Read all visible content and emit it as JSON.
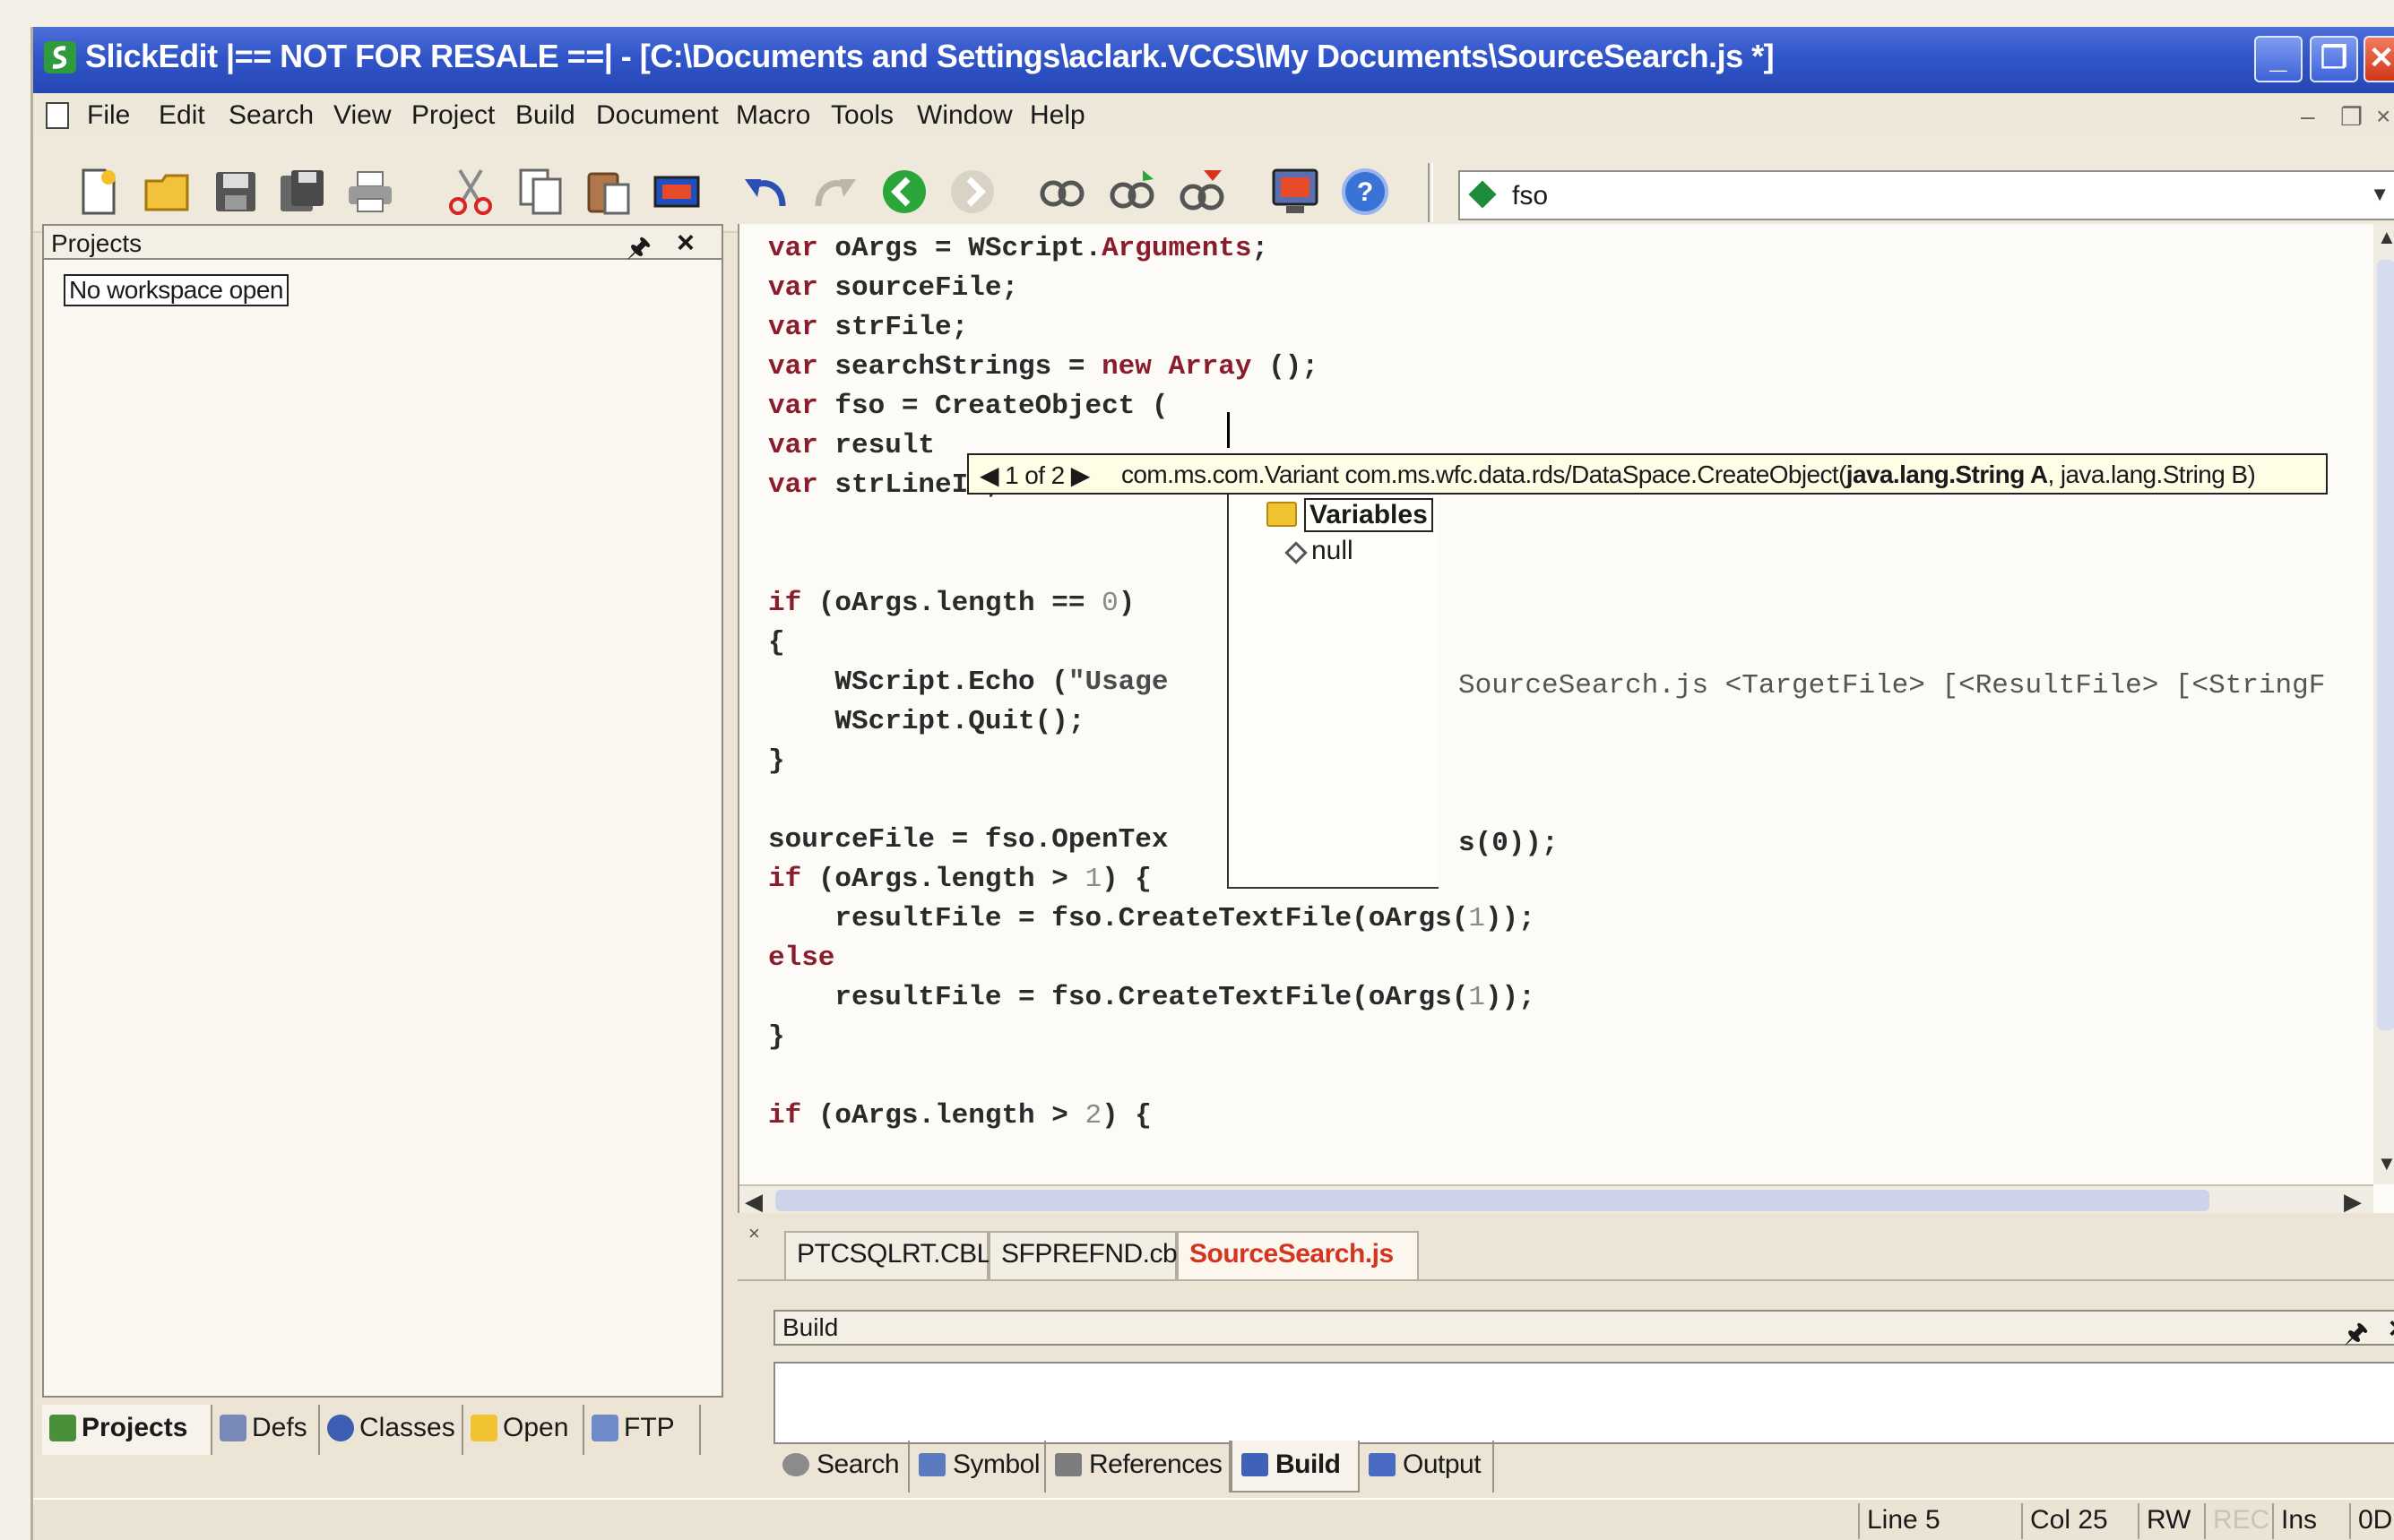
{
  "window": {
    "title": "SlickEdit   |== NOT FOR RESALE ==|   - [C:\\Documents and Settings\\aclark.VCCS\\My Documents\\SourceSearch.js *]",
    "controls": {
      "minimize": "_",
      "maximize": "❐",
      "close": "✕"
    }
  },
  "menu": {
    "items": [
      "File",
      "Edit",
      "Search",
      "View",
      "Project",
      "Build",
      "Document",
      "Macro",
      "Tools",
      "Window",
      "Help"
    ],
    "mdi_controls": [
      "–",
      "❐",
      "×"
    ]
  },
  "toolbar": {
    "buttons": [
      "new-file-icon",
      "open-folder-icon",
      "save-icon",
      "save-all-icon",
      "print-icon",
      "cut-icon",
      "copy-icon",
      "paste-icon",
      "select-block-icon",
      "undo-icon",
      "redo-icon",
      "back-icon",
      "forward-icon",
      "find-references-icon",
      "find-symbol-icon",
      "find-files-icon",
      "monitor-icon",
      "help-icon"
    ],
    "context_value": "fso"
  },
  "projects_panel": {
    "title": "Projects",
    "pin": "🖈",
    "close": "×",
    "workspace_label": "No workspace open",
    "tabs": [
      "Projects",
      "Defs",
      "Classes",
      "Open",
      "FTP"
    ]
  },
  "editor": {
    "code_lines": [
      "var oArgs = WScript.Arguments;",
      "var sourceFile;",
      "var strFile;",
      "var searchStrings = new Array ();",
      "var fso = CreateObject (",
      "var result",
      "var strLineIn;",
      "",
      "",
      "if (oArgs.length == 0)",
      "{",
      "    WScript.Echo (\"Usage",
      "    WScript.Quit();",
      "}",
      "",
      "sourceFile = fso.OpenTex",
      "if (oArgs.length > 1) {",
      "    resultFile = fso.CreateTextFile(oArgs(1));",
      "else",
      "    resultFile = fso.CreateTextFile(oArgs(1));",
      "}",
      "",
      "if (oArgs.length > 2) {"
    ],
    "overflow_fragments": {
      "usage_tail": "SourceSearch.js <TargetFile> [<ResultFile> [<StringF",
      "opentext_tail": "s(0));"
    },
    "param_info": {
      "nav": "◀ 1 of 2 ▶",
      "signature_prefix": "com.ms.com.Variant com.ms.wfc.data.rds/DataSpace.CreateObject(",
      "signature_bold": "java.lang.String A",
      "signature_suffix": ", java.lang.String B)"
    },
    "completion": {
      "category": "Variables",
      "items": [
        "null"
      ]
    }
  },
  "doc_tabs": {
    "close": "×",
    "tabs": [
      {
        "label": "PTCSQLRT.CBL",
        "active": false
      },
      {
        "label": "SFPREFND.cbl",
        "active": false
      },
      {
        "label": "SourceSearch.js",
        "active": true
      }
    ]
  },
  "build_panel": {
    "title": "Build",
    "pin": "🖈",
    "close": "×"
  },
  "tool_tabs": [
    {
      "label": "Search",
      "active": false
    },
    {
      "label": "Symbol",
      "active": false
    },
    {
      "label": "References",
      "active": false
    },
    {
      "label": "Build",
      "active": true
    },
    {
      "label": "Output",
      "active": false
    }
  ],
  "status": {
    "line": "Line 5",
    "col": "Col 25",
    "rw": "RW",
    "rec": "REC",
    "ins": "Ins",
    "tail": "0D"
  },
  "colors": {
    "title_bar": "#3155c9",
    "keyword": "#8a1c2b",
    "active_tab": "#d5341e",
    "tooltip_bg": "#fffde6"
  }
}
